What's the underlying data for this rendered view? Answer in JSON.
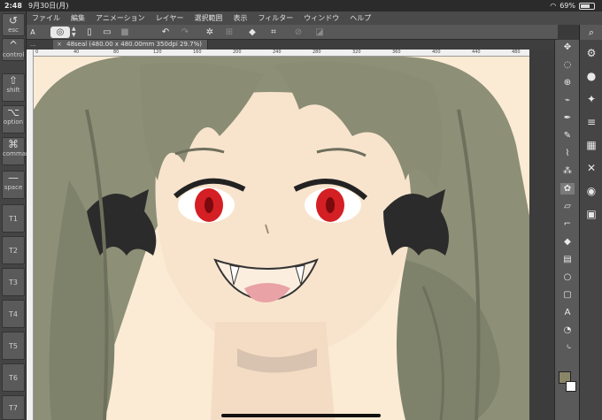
{
  "statusbar": {
    "time": "2:48",
    "date": "9月30日(月)",
    "battery": "69%",
    "battery_level": 0.69
  },
  "menu": [
    "ファイル",
    "編集",
    "アニメーション",
    "レイヤー",
    "選択範囲",
    "表示",
    "フィルター",
    "ウィンドウ",
    "ヘルプ"
  ],
  "rail": [
    {
      "name": "esc",
      "glyph": "↺",
      "label": "esc"
    },
    {
      "name": "ctrl",
      "glyph": "^",
      "label": "control"
    },
    {
      "name": "shift",
      "glyph": "⇧",
      "label": "shift"
    },
    {
      "name": "option",
      "glyph": "⌥",
      "label": "option"
    },
    {
      "name": "command",
      "glyph": "⌘",
      "label": "command"
    },
    {
      "name": "space",
      "glyph": "—",
      "label": "space"
    },
    {
      "name": "t1",
      "glyph": "",
      "label": "T1"
    },
    {
      "name": "t2",
      "glyph": "",
      "label": "T2"
    },
    {
      "name": "t3",
      "glyph": "",
      "label": "T3"
    },
    {
      "name": "t4",
      "glyph": "",
      "label": "T4"
    },
    {
      "name": "t5",
      "glyph": "",
      "label": "T5"
    },
    {
      "name": "t6",
      "glyph": "",
      "label": "T6"
    },
    {
      "name": "t7",
      "glyph": "",
      "label": "T7"
    }
  ],
  "toolbar": {
    "prefix": "A"
  },
  "document": {
    "tab_label": "48seal (480.00 x 480.00mm 350dpi 29.7%)",
    "prev_marker": "..."
  },
  "ruler_ticks": [
    "0",
    "40",
    "80",
    "120",
    "160",
    "200",
    "240",
    "280",
    "320",
    "360",
    "400",
    "440",
    "480"
  ],
  "colors": {
    "main": "#8b8568",
    "sub": "#ffffff",
    "canvas_bg": "#fbebd4",
    "eye": "#d41f24"
  },
  "tools": [
    "move",
    "lasso",
    "zoom",
    "eyedropper",
    "pen",
    "pencil",
    "brush",
    "airbrush",
    "decoration",
    "eraser",
    "blend",
    "fill",
    "gradient",
    "figure",
    "frame",
    "text",
    "balloon",
    "ruler"
  ]
}
